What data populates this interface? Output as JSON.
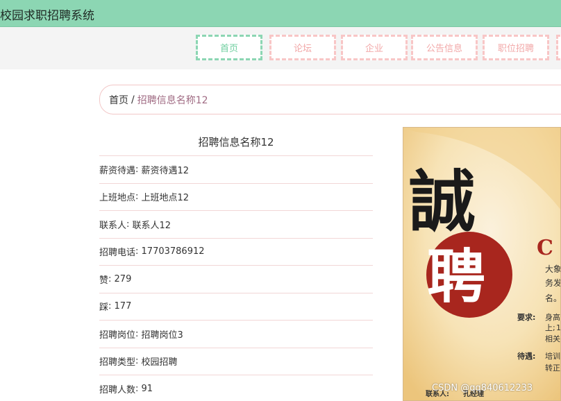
{
  "app": {
    "title": "校园求职招聘系统"
  },
  "nav": {
    "items": [
      {
        "label": "首页",
        "active": true
      },
      {
        "label": "论坛",
        "active": false
      },
      {
        "label": "企业",
        "active": false
      },
      {
        "label": "公告信息",
        "active": false
      },
      {
        "label": "职位招聘",
        "active": false
      }
    ]
  },
  "breadcrumb": {
    "home": "首页",
    "separator": "/",
    "current": "招聘信息名称12"
  },
  "detail": {
    "title": "招聘信息名称12",
    "fields": [
      {
        "label": "薪资待遇",
        "value": "薪资待遇12"
      },
      {
        "label": "上班地点",
        "value": "上班地点12"
      },
      {
        "label": "联系人",
        "value": "联系人12"
      },
      {
        "label": "招聘电话",
        "value": "17703786912"
      },
      {
        "label": "赞",
        "value": "279"
      },
      {
        "label": "踩",
        "value": "177"
      },
      {
        "label": "招聘岗位",
        "value": "招聘岗位3"
      },
      {
        "label": "招聘类型",
        "value": "校园招聘"
      },
      {
        "label": "招聘人数",
        "value": "91"
      }
    ]
  },
  "poster": {
    "big_char_1": "誠",
    "big_char_2": "聘",
    "heading_partial": "C",
    "line_1": "大象",
    "line_2": "务发",
    "line_3": "名。",
    "req_label": "要求:",
    "req_1": "身高",
    "req_2": "上;",
    "req_2_digit": "1",
    "req_3": "相关",
    "pay_label": "待遇:",
    "pay_1": "培训",
    "pay_2": "转正",
    "contact_label": "联系人:",
    "contact_value": "孔经理"
  },
  "watermark": "CSDN @qq840612233",
  "colors": {
    "header": "#8cd6b3",
    "active_nav": "#6fcf9f",
    "nav_border": "#f8c6c6",
    "seal_red": "#a8261e"
  }
}
